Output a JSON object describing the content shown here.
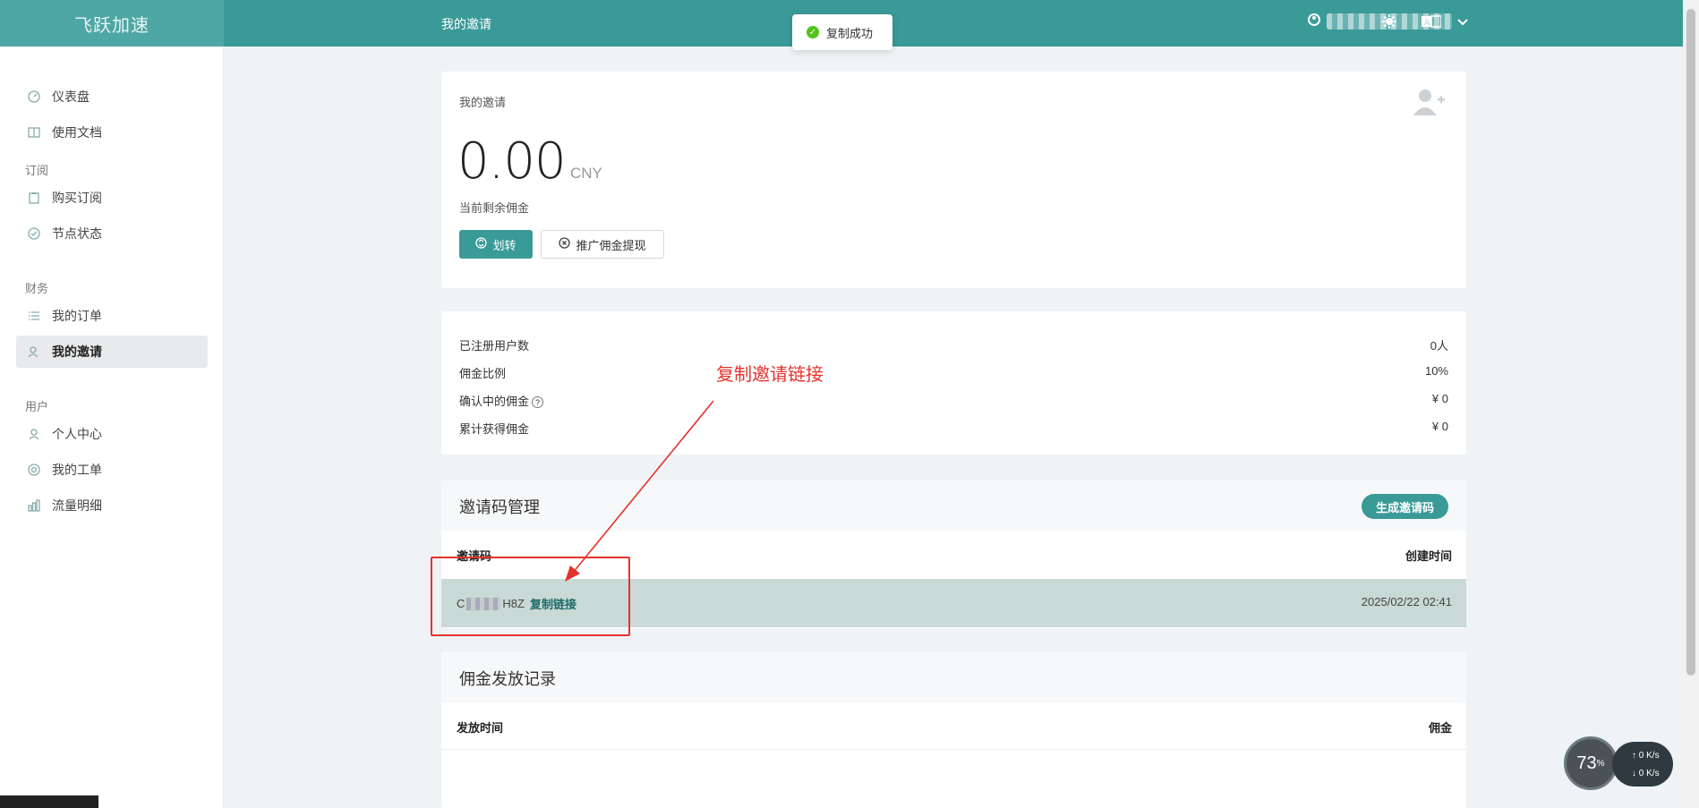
{
  "header": {
    "logo": "飞跃加速",
    "page_title": "我的邀请"
  },
  "toast": {
    "text": "复制成功"
  },
  "sidebar": {
    "items": [
      {
        "label": "仪表盘",
        "icon": "dashboard-icon"
      },
      {
        "label": "使用文档",
        "icon": "book-icon"
      }
    ],
    "sections": [
      {
        "title": "订阅",
        "items": [
          {
            "label": "购买订阅"
          },
          {
            "label": "节点状态"
          }
        ]
      },
      {
        "title": "财务",
        "items": [
          {
            "label": "我的订单"
          },
          {
            "label": "我的邀请"
          }
        ]
      },
      {
        "title": "用户",
        "items": [
          {
            "label": "个人中心"
          },
          {
            "label": "我的工单"
          },
          {
            "label": "流量明细"
          }
        ]
      }
    ]
  },
  "invite_card": {
    "title": "我的邀请",
    "amount": "0.00",
    "currency": "CNY",
    "remain_label": "当前剩余佣金",
    "transfer_label": "划转",
    "withdraw_label": "推广佣金提现"
  },
  "stats": [
    {
      "label": "已注册用户数",
      "value": "0人"
    },
    {
      "label": "佣金比例",
      "value": "10%"
    },
    {
      "label": "确认中的佣金",
      "value": "¥ 0"
    },
    {
      "label": "累计获得佣金",
      "value": "¥ 0"
    }
  ],
  "code_mgmt": {
    "title": "邀请码管理",
    "generate_label": "生成邀请码",
    "col_code": "邀请码",
    "col_created": "创建时间",
    "row": {
      "code_prefix": "C",
      "code_suffix": "H8Z",
      "copy_label": "复制链接",
      "created": "2025/02/22 02:41"
    }
  },
  "commission": {
    "title": "佣金发放记录",
    "col_time": "发放时间",
    "col_amount": "佣金"
  },
  "annotation": {
    "text": "复制邀请链接"
  },
  "widget": {
    "percent": "73",
    "up": "0",
    "down": "0",
    "unit": "K/s"
  },
  "colors": {
    "primary": "#3a9a98",
    "annotation": "#e5322d"
  }
}
